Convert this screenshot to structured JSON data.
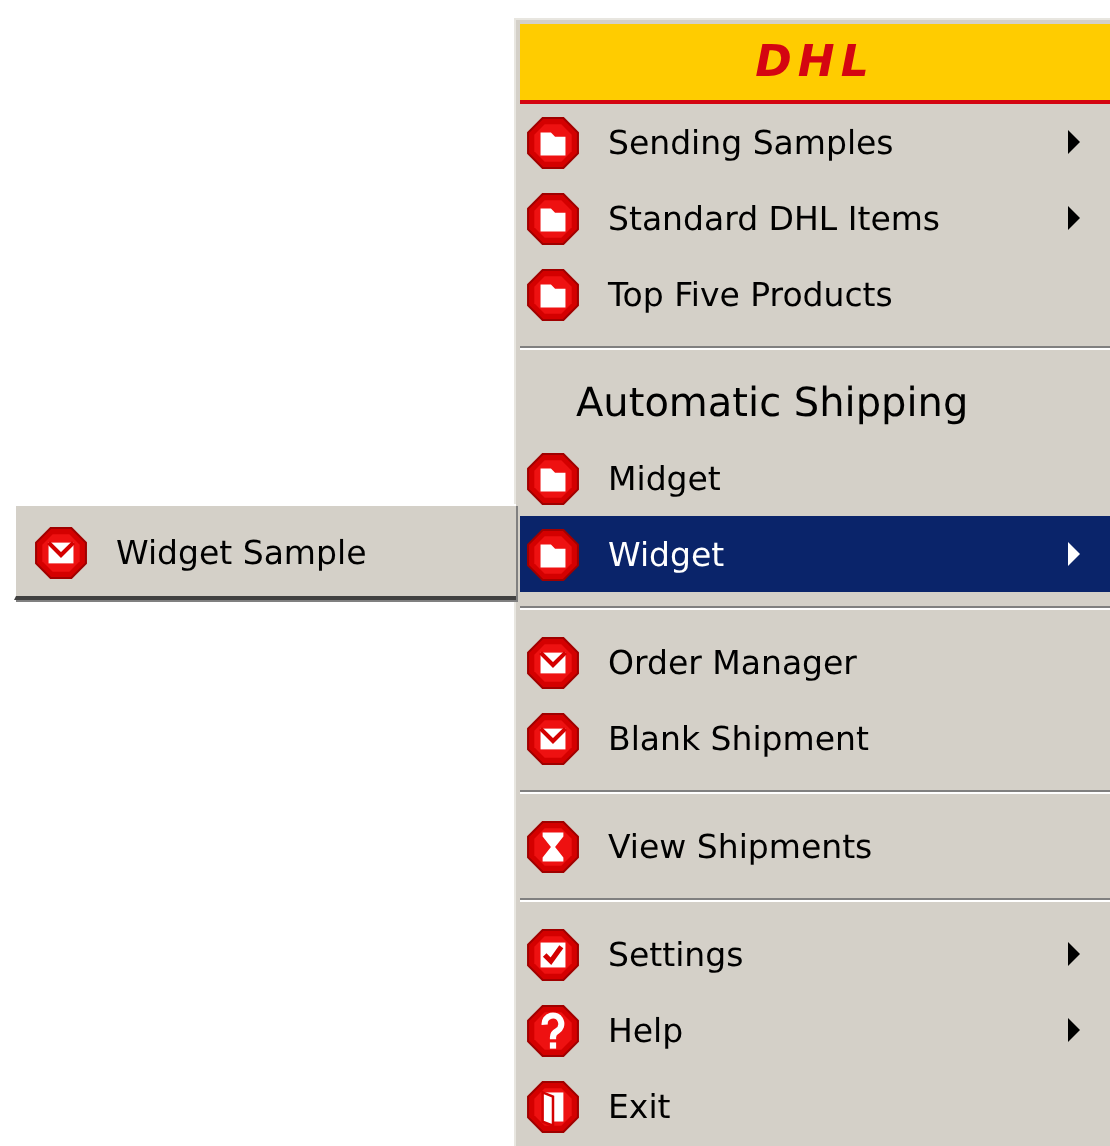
{
  "logo": "DHL",
  "menu": [
    {
      "kind": "item",
      "label": "Sending Samples",
      "submenu": true,
      "selected": false
    },
    {
      "kind": "item",
      "label": "Standard DHL Items",
      "submenu": true,
      "selected": false
    },
    {
      "kind": "item",
      "label": "Top Five Products",
      "submenu": false,
      "selected": false
    },
    {
      "kind": "separator"
    },
    {
      "kind": "heading",
      "label": "Automatic Shipping"
    },
    {
      "kind": "item",
      "label": "Midget",
      "submenu": false,
      "selected": false
    },
    {
      "kind": "item",
      "label": "Widget",
      "submenu": true,
      "selected": true
    },
    {
      "kind": "separator"
    },
    {
      "kind": "item",
      "label": "Order Manager",
      "submenu": false,
      "selected": false
    },
    {
      "kind": "item",
      "label": "Blank Shipment",
      "submenu": false,
      "selected": false
    },
    {
      "kind": "separator"
    },
    {
      "kind": "item",
      "label": "View Shipments",
      "submenu": false,
      "selected": false
    },
    {
      "kind": "separator"
    },
    {
      "kind": "item",
      "label": "Settings",
      "submenu": true,
      "selected": false
    },
    {
      "kind": "item",
      "label": "Help",
      "submenu": true,
      "selected": false
    },
    {
      "kind": "item",
      "label": "Exit",
      "submenu": false,
      "selected": false
    }
  ],
  "submenu": [
    {
      "label": "Widget Sample",
      "selected": false
    }
  ]
}
